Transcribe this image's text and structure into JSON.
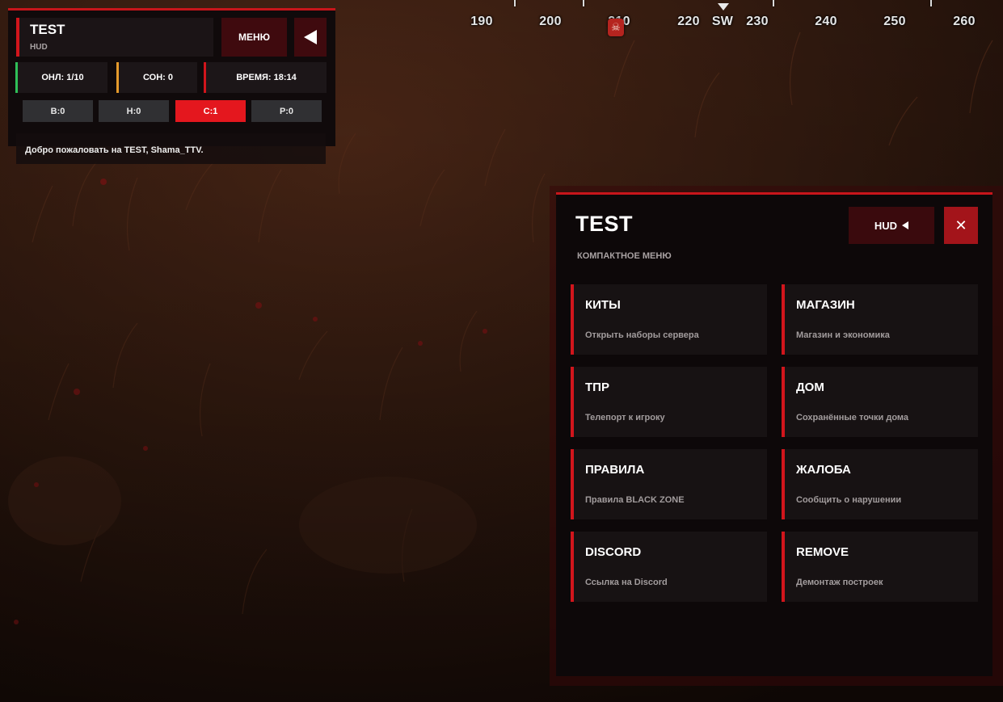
{
  "compass": {
    "labels": [
      "190",
      "200",
      "210",
      "220",
      "SW",
      "230",
      "240",
      "250",
      "260"
    ],
    "marker_icon": "skull-icon"
  },
  "hud": {
    "title": "TEST",
    "subtitle": "HUD",
    "menu_label": "МЕНЮ",
    "collapse_icon": "triangle-left-icon",
    "stats": {
      "online": "ОНЛ: 1/10",
      "sleep": "СОН: 0",
      "time": "ВРЕМЯ: 18:14"
    },
    "counters": [
      "В:0",
      "Н:0",
      "С:1",
      "Р:0"
    ],
    "active_counter": "С:1",
    "welcome": "Добро пожаловать на TEST, Shama_TTV."
  },
  "menu": {
    "title": "TEST",
    "subtitle": "КОМПАКТНОЕ МЕНЮ",
    "hud_button": "HUD",
    "close_icon": "close-icon",
    "items": [
      {
        "title": "КИТЫ",
        "desc": "Открыть наборы сервера"
      },
      {
        "title": "МАГАЗИН",
        "desc": "Магазин и экономика"
      },
      {
        "title": "ТПР",
        "desc": "Телепорт к игроку"
      },
      {
        "title": "ДОМ",
        "desc": "Сохранённые точки дома"
      },
      {
        "title": "ПРАВИЛА",
        "desc": "Правила BLACK ZONE"
      },
      {
        "title": "ЖАЛОБА",
        "desc": "Сообщить о нарушении"
      },
      {
        "title": "DISCORD",
        "desc": "Ссылка на Discord"
      },
      {
        "title": "REMOVE",
        "desc": "Демонтаж построек"
      }
    ]
  },
  "colors": {
    "accent_red": "#d1151c",
    "online_green": "#2fbf58",
    "sleep_orange": "#e59a2b",
    "active_counter": "#e4171e"
  }
}
